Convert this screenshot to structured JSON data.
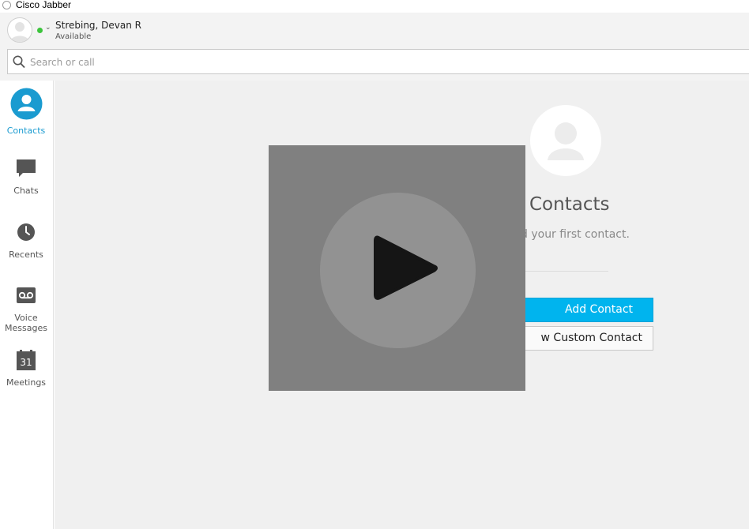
{
  "window": {
    "title": "Cisco Jabber"
  },
  "user": {
    "name": "Strebing, Devan R",
    "status": "Available",
    "status_color": "#3cc43c"
  },
  "search": {
    "placeholder": "Search or call"
  },
  "sidebar": {
    "items": [
      {
        "label": "Contacts",
        "icon": "contacts-icon",
        "active": true
      },
      {
        "label": "Chats",
        "icon": "chat-icon"
      },
      {
        "label": "Recents",
        "icon": "clock-icon"
      },
      {
        "label": "Voice",
        "label2": "Messages",
        "icon": "voicemail-icon"
      },
      {
        "label": "Meetings",
        "icon": "calendar-icon",
        "icon_text": "31"
      }
    ]
  },
  "empty_state": {
    "title": "Contacts",
    "subtitle": "d your first contact.",
    "add_button": "Add Contact",
    "custom_button": "w Custom Contact"
  },
  "colors": {
    "accent": "#1a9bd0",
    "button_primary": "#00b4ee",
    "overlay": "#808080"
  }
}
